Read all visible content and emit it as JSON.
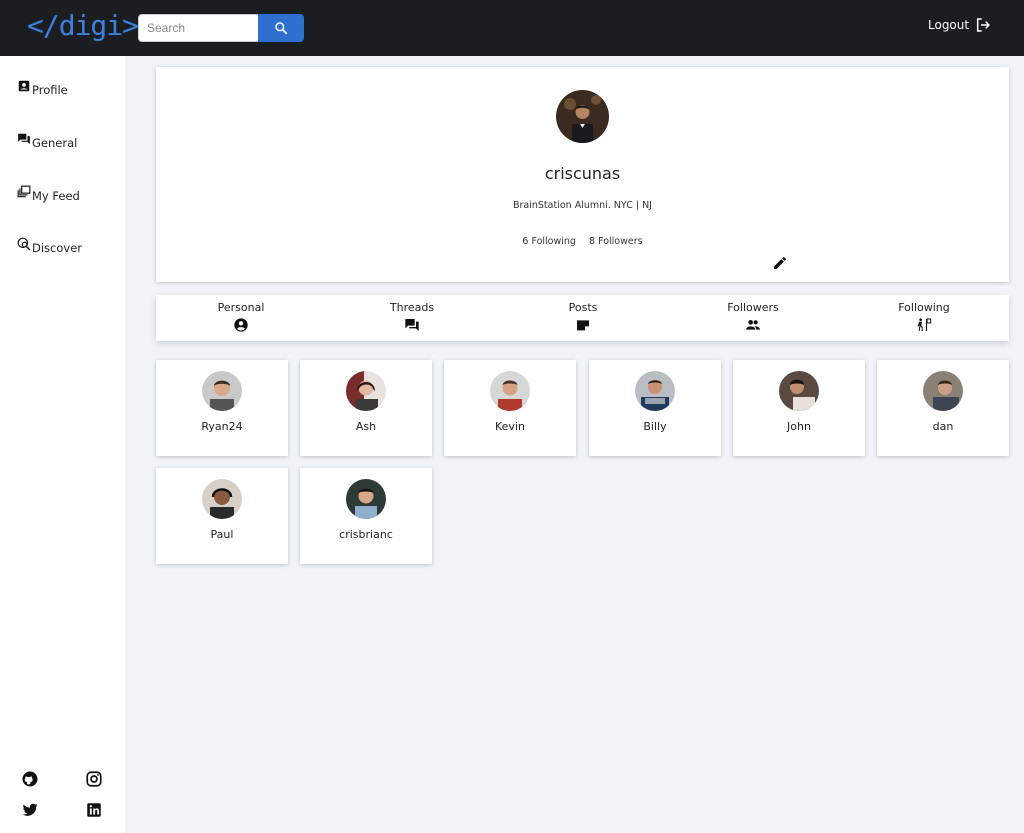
{
  "header": {
    "logo_text": "</digi>",
    "search_placeholder": "Search",
    "search_icon": "search-icon",
    "logout_label": "Logout",
    "logout_icon": "logout-icon",
    "accent_color": "#2f6fd0"
  },
  "sidebar": {
    "items": [
      {
        "label": "Profile",
        "icon": "profile-icon"
      },
      {
        "label": "General",
        "icon": "chat-icon"
      },
      {
        "label": "My Feed",
        "icon": "feed-icon"
      },
      {
        "label": "Discover",
        "icon": "discover-icon"
      }
    ],
    "social": [
      "github-icon",
      "instagram-icon",
      "twitter-icon",
      "linkedin-icon"
    ]
  },
  "profile": {
    "username": "criscunas",
    "bio": "BrainStation Alumni. NYC | NJ",
    "following_label": "6 Following",
    "followers_label": "8 Followers",
    "edit_icon": "pencil-icon"
  },
  "tabs": [
    {
      "label": "Personal",
      "icon": "account-circle-icon"
    },
    {
      "label": "Threads",
      "icon": "forum-icon"
    },
    {
      "label": "Posts",
      "icon": "note-icon"
    },
    {
      "label": "Followers",
      "icon": "people-icon"
    },
    {
      "label": "Following",
      "icon": "follow-walk-icon"
    }
  ],
  "followers": [
    {
      "name": "Ryan24"
    },
    {
      "name": "Ash"
    },
    {
      "name": "Kevin"
    },
    {
      "name": "Billy"
    },
    {
      "name": "John"
    },
    {
      "name": "dan"
    },
    {
      "name": "Paul"
    },
    {
      "name": "crisbrianc"
    }
  ]
}
